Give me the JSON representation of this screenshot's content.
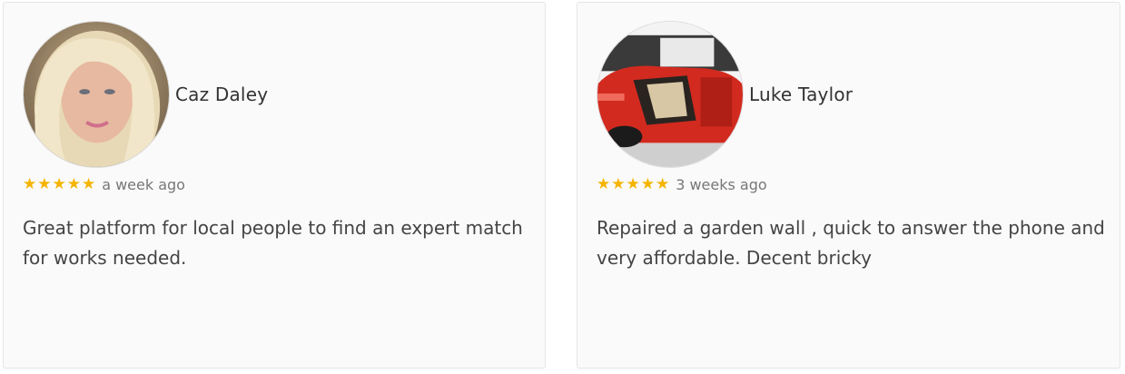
{
  "reviews": [
    {
      "name": "Caz Daley",
      "stars": "★★★★★",
      "rating": 5,
      "time": "a week ago",
      "text": "Great platform for local people to find an expert match for works needed.",
      "avatar_icon": "woman-portrait-photo"
    },
    {
      "name": "Luke Taylor",
      "stars": "★★★★★",
      "rating": 5,
      "time": "3 weeks ago",
      "text": "Repaired a garden wall , quick to answer the phone and very affordable. Decent bricky",
      "avatar_icon": "red-car-photo"
    }
  ],
  "colors": {
    "star": "#f5b400",
    "card_bg": "#fafafa",
    "name": "#333333",
    "time": "#777777",
    "text": "#444444"
  }
}
